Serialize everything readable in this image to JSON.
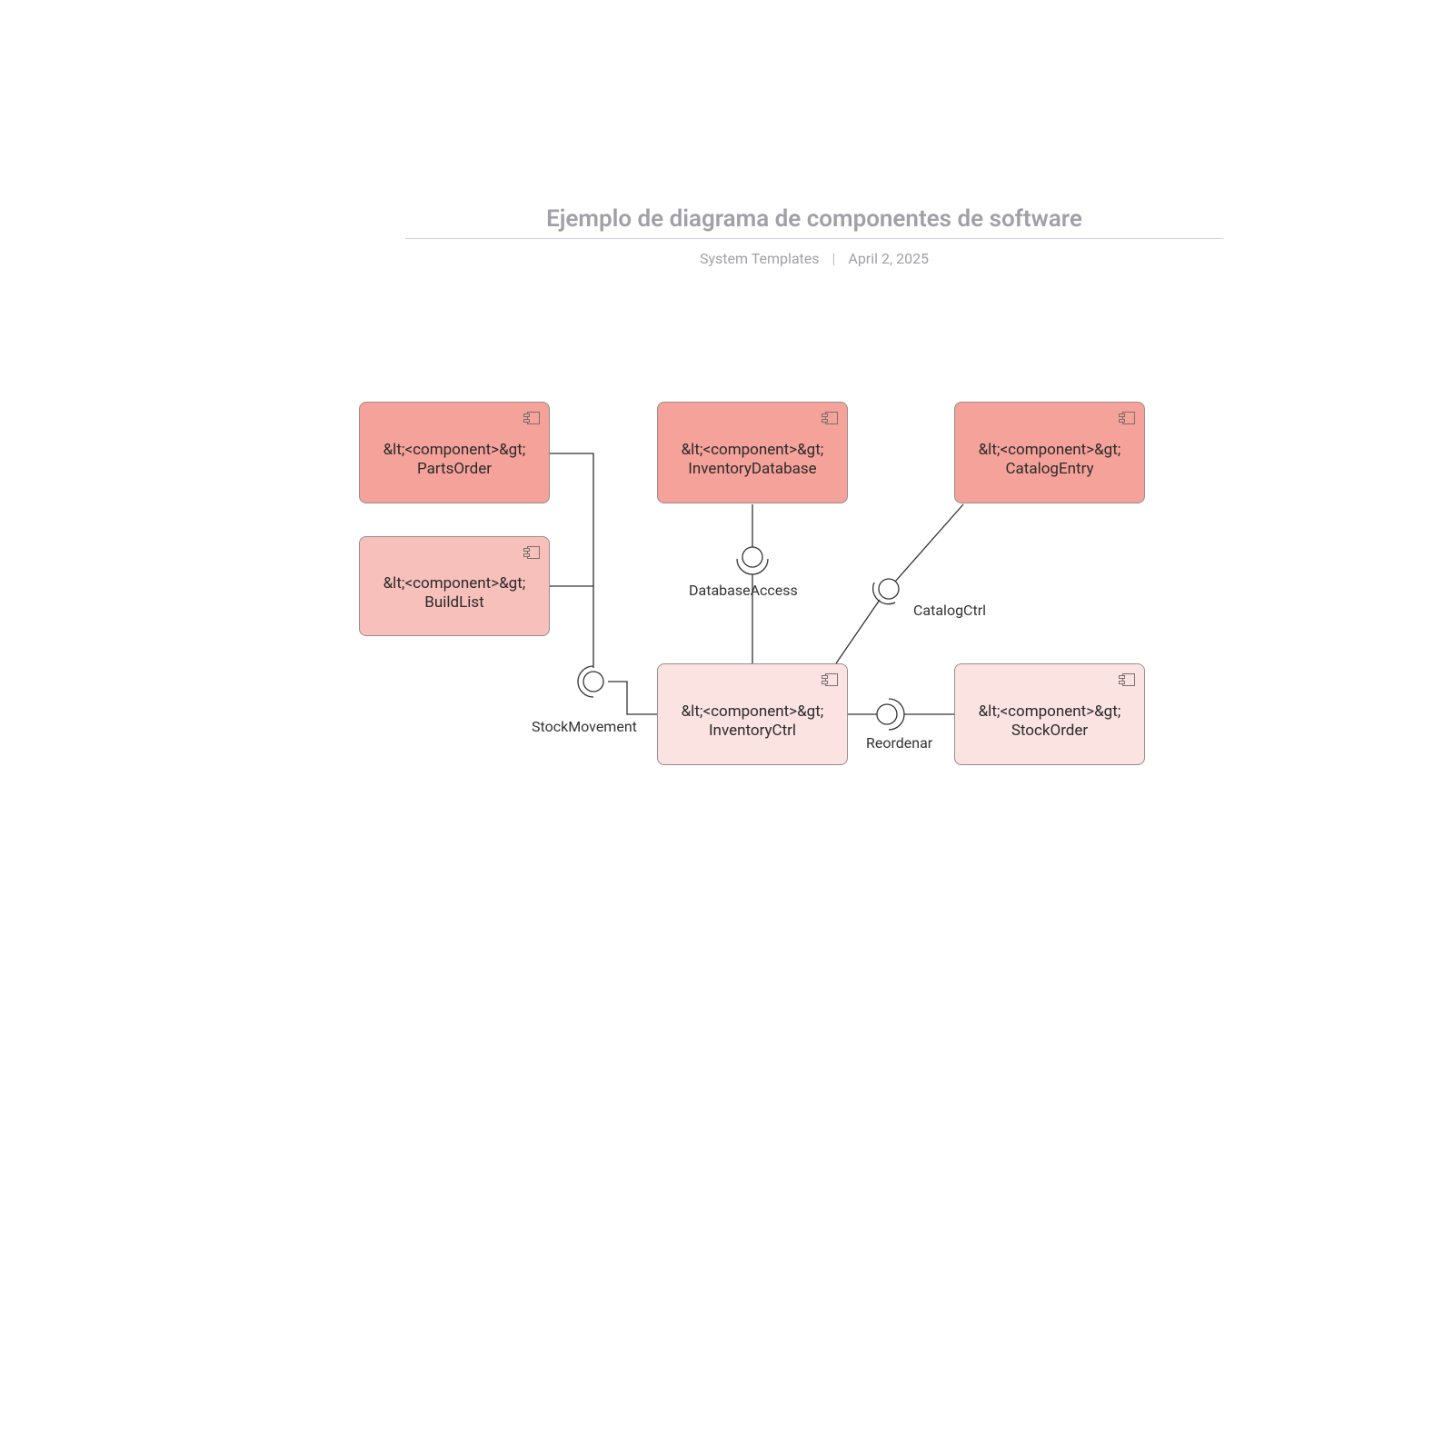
{
  "header": {
    "title": "Ejemplo de diagrama de componentes de software",
    "author": "System Templates",
    "date": "April 2, 2025"
  },
  "components": {
    "partsOrder": {
      "stereotype": "&lt;<component>&gt;",
      "name": "PartsOrder"
    },
    "inventoryDatabase": {
      "stereotype": "&lt;<component>&gt;",
      "name": "InventoryDatabase"
    },
    "catalogEntry": {
      "stereotype": "&lt;<component>&gt;",
      "name": "CatalogEntry"
    },
    "buildList": {
      "stereotype": "&lt;<component>&gt;",
      "name": "BuildList"
    },
    "inventoryCtrl": {
      "stereotype": "&lt;<component>&gt;",
      "name": "InventoryCtrl"
    },
    "stockOrder": {
      "stereotype": "&lt;<component>&gt;",
      "name": "StockOrder"
    }
  },
  "interfaces": {
    "stockMovement": "StockMovement",
    "databaseAccess": "DatabaseAccess",
    "catalogCtrl": "CatalogCtrl",
    "reorder": "Reordenar"
  },
  "colors": {
    "dark": "#f5a29a",
    "medium": "#f7c0bb",
    "light": "#fbe3e2",
    "border": "#9a8c8c",
    "title": "#a0a0a8"
  },
  "chart_data": {
    "type": "diagram",
    "title": "Ejemplo de diagrama de componentes de software",
    "nodes": [
      {
        "id": "PartsOrder",
        "stereotype": "<component>",
        "shade": "dark"
      },
      {
        "id": "InventoryDatabase",
        "stereotype": "<component>",
        "shade": "dark"
      },
      {
        "id": "CatalogEntry",
        "stereotype": "<component>",
        "shade": "dark"
      },
      {
        "id": "BuildList",
        "stereotype": "<component>",
        "shade": "medium"
      },
      {
        "id": "InventoryCtrl",
        "stereotype": "<component>",
        "shade": "light"
      },
      {
        "id": "StockOrder",
        "stereotype": "<component>",
        "shade": "light"
      }
    ],
    "interfaces": [
      {
        "name": "StockMovement",
        "provided_by": "InventoryCtrl",
        "required_by": [
          "PartsOrder",
          "BuildList"
        ]
      },
      {
        "name": "DatabaseAccess",
        "provided_by": "InventoryDatabase",
        "required_by": [
          "InventoryCtrl"
        ]
      },
      {
        "name": "CatalogCtrl",
        "provided_by": "CatalogEntry",
        "required_by": [
          "InventoryCtrl"
        ]
      },
      {
        "name": "Reordenar",
        "provided_by": "InventoryCtrl",
        "required_by": [
          "StockOrder"
        ]
      }
    ]
  }
}
